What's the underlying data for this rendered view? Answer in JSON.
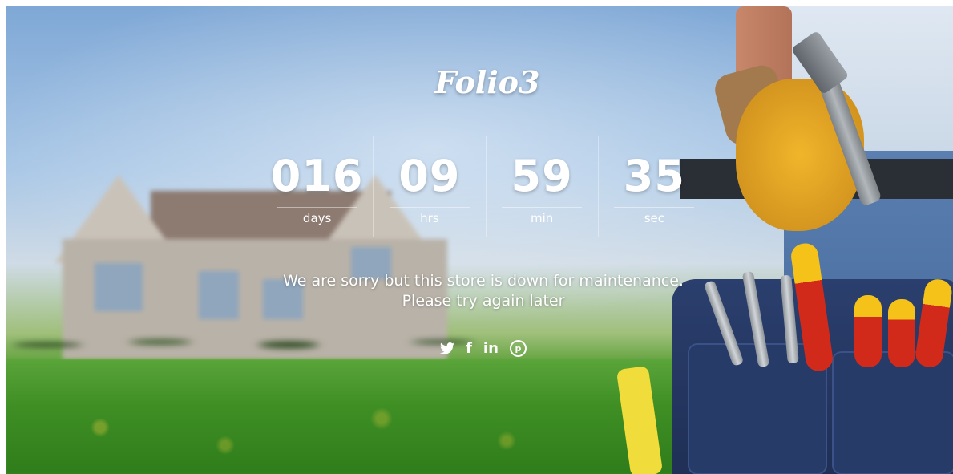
{
  "brand": {
    "logo_text": "Folio3"
  },
  "countdown": {
    "days": {
      "value": "016",
      "label": "days"
    },
    "hours": {
      "value": "09",
      "label": "hrs"
    },
    "minutes": {
      "value": "59",
      "label": "min"
    },
    "seconds": {
      "value": "35",
      "label": "sec"
    }
  },
  "message": {
    "line1": "We are sorry but this store is down for maintenance.",
    "line2": "Please try again later"
  },
  "social": {
    "twitter": {
      "icon": "twitter-icon"
    },
    "facebook": {
      "icon": "facebook-icon",
      "glyph": "f"
    },
    "linkedin": {
      "icon": "linkedin-icon",
      "glyph": "in"
    },
    "pinterest": {
      "icon": "pinterest-icon",
      "glyph": "p"
    }
  }
}
